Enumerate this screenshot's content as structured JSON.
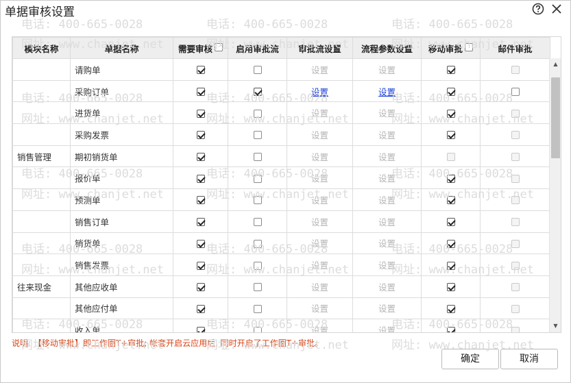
{
  "dialog": {
    "title": "单据审核设置",
    "help_icon": "question-circle-icon",
    "close_icon": "close-icon"
  },
  "watermark": {
    "phone": "电话: 400-665-0028",
    "site": "网址: www.chanjet.net"
  },
  "columns": [
    {
      "label": "模块名称",
      "has_checkbox": false
    },
    {
      "label": "单据名称",
      "has_checkbox": false
    },
    {
      "label": "需要审核",
      "has_checkbox": true,
      "checked": false
    },
    {
      "label": "启用审批流",
      "has_checkbox": false
    },
    {
      "label": "审批流设置",
      "has_checkbox": false
    },
    {
      "label": "流程参数设置",
      "has_checkbox": false
    },
    {
      "label": "移动审批",
      "has_checkbox": true,
      "checked": false
    },
    {
      "label": "邮件审批",
      "has_checkbox": false
    }
  ],
  "rows": [
    {
      "module": "",
      "doc": "请购单",
      "need_review": true,
      "enable_flow": false,
      "flow_setting": "设置",
      "flow_active": false,
      "param_setting": "设置",
      "param_active": false,
      "mobile": true,
      "mobile_disabled": false,
      "email": false,
      "email_disabled": true
    },
    {
      "module": "",
      "doc": "采购订单",
      "need_review": true,
      "enable_flow": true,
      "flow_setting": "设置",
      "flow_active": true,
      "param_setting": "设置",
      "param_active": true,
      "mobile": true,
      "mobile_disabled": false,
      "email": false,
      "email_disabled": false
    },
    {
      "module": "",
      "doc": "进货单",
      "need_review": true,
      "enable_flow": false,
      "flow_setting": "设置",
      "flow_active": false,
      "param_setting": "设置",
      "param_active": false,
      "mobile": true,
      "mobile_disabled": false,
      "email": false,
      "email_disabled": true
    },
    {
      "module": "",
      "doc": "采购发票",
      "need_review": true,
      "enable_flow": false,
      "flow_setting": "设置",
      "flow_active": false,
      "param_setting": "设置",
      "param_active": false,
      "mobile": true,
      "mobile_disabled": false,
      "email": false,
      "email_disabled": true
    },
    {
      "module": "销售管理",
      "doc": "期初销货单",
      "need_review": true,
      "enable_flow": false,
      "flow_setting": "设置",
      "flow_active": false,
      "param_setting": "设置",
      "param_active": false,
      "mobile": false,
      "mobile_disabled": true,
      "email": false,
      "email_disabled": true
    },
    {
      "module": "",
      "doc": "报价单",
      "need_review": true,
      "enable_flow": false,
      "flow_setting": "设置",
      "flow_active": false,
      "param_setting": "设置",
      "param_active": false,
      "mobile": true,
      "mobile_disabled": false,
      "email": false,
      "email_disabled": true
    },
    {
      "module": "",
      "doc": "预测单",
      "need_review": true,
      "enable_flow": false,
      "flow_setting": "设置",
      "flow_active": false,
      "param_setting": "设置",
      "param_active": false,
      "mobile": true,
      "mobile_disabled": false,
      "email": false,
      "email_disabled": true
    },
    {
      "module": "",
      "doc": "销售订单",
      "need_review": true,
      "enable_flow": false,
      "flow_setting": "设置",
      "flow_active": false,
      "param_setting": "设置",
      "param_active": false,
      "mobile": true,
      "mobile_disabled": false,
      "email": false,
      "email_disabled": true
    },
    {
      "module": "",
      "doc": "销货单",
      "need_review": true,
      "enable_flow": false,
      "flow_setting": "设置",
      "flow_active": false,
      "param_setting": "设置",
      "param_active": false,
      "mobile": true,
      "mobile_disabled": false,
      "email": false,
      "email_disabled": true
    },
    {
      "module": "",
      "doc": "销售发票",
      "need_review": true,
      "enable_flow": false,
      "flow_setting": "设置",
      "flow_active": false,
      "param_setting": "设置",
      "param_active": false,
      "mobile": true,
      "mobile_disabled": false,
      "email": false,
      "email_disabled": true
    },
    {
      "module": "往来现金",
      "doc": "其他应收单",
      "need_review": true,
      "enable_flow": false,
      "flow_setting": "设置",
      "flow_active": false,
      "param_setting": "设置",
      "param_active": false,
      "mobile": true,
      "mobile_disabled": false,
      "email": false,
      "email_disabled": true
    },
    {
      "module": "",
      "doc": "其他应付单",
      "need_review": true,
      "enable_flow": false,
      "flow_setting": "设置",
      "flow_active": false,
      "param_setting": "设置",
      "param_active": false,
      "mobile": true,
      "mobile_disabled": false,
      "email": false,
      "email_disabled": true
    },
    {
      "module": "",
      "doc": "收入单",
      "need_review": true,
      "enable_flow": false,
      "flow_setting": "设置",
      "flow_active": false,
      "param_setting": "设置",
      "param_active": false,
      "mobile": true,
      "mobile_disabled": false,
      "email": false,
      "email_disabled": true
    }
  ],
  "note": "说明: 【移动审批】即工作圈T+审批; 帐套开启云应用后, 同时开启了工作圈T+审批。",
  "buttons": {
    "ok": "确定",
    "cancel": "取消"
  },
  "scrollbar": {
    "up_icon": "triangle-up-icon",
    "down_icon": "triangle-down-icon"
  }
}
